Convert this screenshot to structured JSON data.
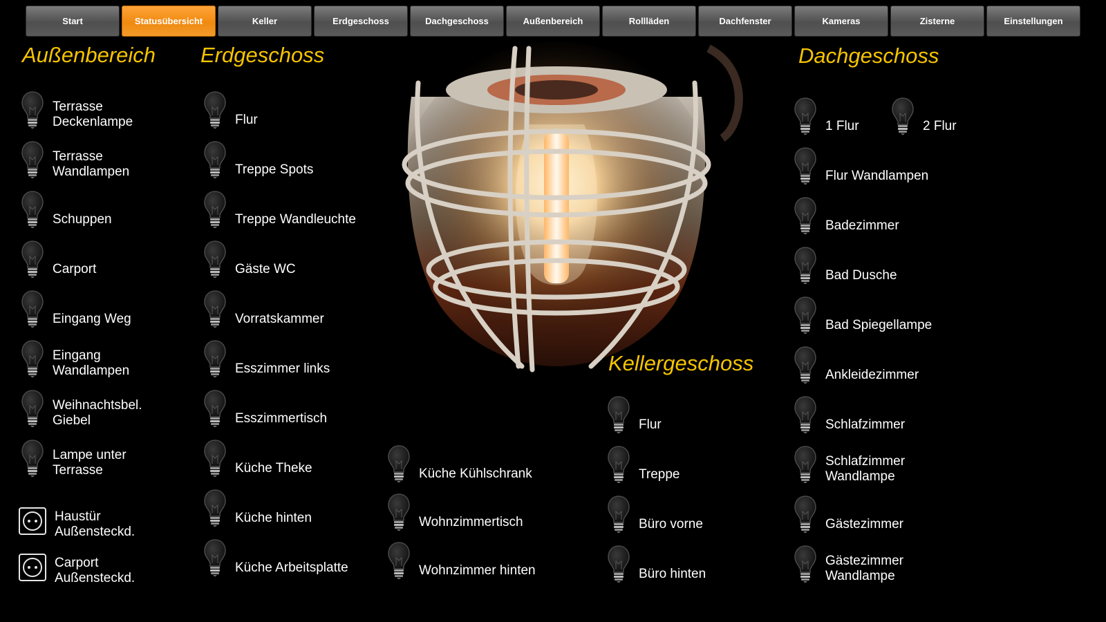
{
  "nav": {
    "tabs": [
      {
        "label": "Start",
        "active": false
      },
      {
        "label": "Statusübersicht",
        "active": true
      },
      {
        "label": "Keller",
        "active": false
      },
      {
        "label": "Erdgeschoss",
        "active": false
      },
      {
        "label": "Dachgeschoss",
        "active": false
      },
      {
        "label": "Außenbereich",
        "active": false
      },
      {
        "label": "Rollläden",
        "active": false
      },
      {
        "label": "Dachfenster",
        "active": false
      },
      {
        "label": "Kameras",
        "active": false
      },
      {
        "label": "Zisterne",
        "active": false
      },
      {
        "label": "Einstellungen",
        "active": false
      }
    ]
  },
  "colors": {
    "accent": "#f6c400",
    "active_tab": "#f59420",
    "tab": "#5f5f5f"
  },
  "sections": {
    "aussen": {
      "title": "Außenbereich",
      "items": [
        {
          "label": "Terrasse\nDeckenlampe",
          "icon": "bulb-icon"
        },
        {
          "label": "Terrasse\nWandlampen",
          "icon": "bulb-icon"
        },
        {
          "label": "Schuppen",
          "icon": "bulb-icon"
        },
        {
          "label": "Carport",
          "icon": "bulb-icon"
        },
        {
          "label": "Eingang Weg",
          "icon": "bulb-icon"
        },
        {
          "label": "Eingang\nWandlampen",
          "icon": "bulb-icon"
        },
        {
          "label": "Weihnachtsbel.\nGiebel",
          "icon": "bulb-icon"
        },
        {
          "label": "Lampe unter\nTerrasse",
          "icon": "bulb-icon"
        },
        {
          "label": "Haustür\nAußensteckd.",
          "icon": "socket-icon"
        },
        {
          "label": "Carport\nAußensteckd.",
          "icon": "socket-icon"
        }
      ]
    },
    "erd": {
      "title": "Erdgeschoss",
      "items": [
        {
          "label": "Flur",
          "icon": "bulb-icon"
        },
        {
          "label": "Treppe Spots",
          "icon": "bulb-icon"
        },
        {
          "label": "Treppe Wandleuchte",
          "icon": "bulb-icon"
        },
        {
          "label": "Gäste WC",
          "icon": "bulb-icon"
        },
        {
          "label": "Vorratskammer",
          "icon": "bulb-icon"
        },
        {
          "label": "Esszimmer links",
          "icon": "bulb-icon"
        },
        {
          "label": "Esszimmertisch",
          "icon": "bulb-icon"
        },
        {
          "label": "Küche Theke",
          "icon": "bulb-icon"
        },
        {
          "label": "Küche hinten",
          "icon": "bulb-icon"
        },
        {
          "label": "Küche Arbeitsplatte",
          "icon": "bulb-icon"
        }
      ],
      "extra_items": [
        {
          "label": "Küche Kühlschrank",
          "icon": "bulb-icon"
        },
        {
          "label": "Wohnzimmertisch",
          "icon": "bulb-icon"
        },
        {
          "label": "Wohnzimmer hinten",
          "icon": "bulb-icon"
        }
      ]
    },
    "keller": {
      "title": "Kellergeschoss",
      "items": [
        {
          "label": "Flur",
          "icon": "bulb-icon"
        },
        {
          "label": "Treppe",
          "icon": "bulb-icon"
        },
        {
          "label": "Büro vorne",
          "icon": "bulb-icon"
        },
        {
          "label": "Büro hinten",
          "icon": "bulb-icon"
        }
      ]
    },
    "dach": {
      "title": "Dachgeschoss",
      "items": [
        {
          "label": "1 Flur",
          "icon": "bulb-icon"
        },
        {
          "label": "2 Flur",
          "icon": "bulb-icon"
        },
        {
          "label": "Flur Wandlampen",
          "icon": "bulb-icon"
        },
        {
          "label": "Badezimmer",
          "icon": "bulb-icon"
        },
        {
          "label": "Bad Dusche",
          "icon": "bulb-icon"
        },
        {
          "label": "Bad Spiegellampe",
          "icon": "bulb-icon"
        },
        {
          "label": "Ankleidezimmer",
          "icon": "bulb-icon"
        },
        {
          "label": "Schlafzimmer",
          "icon": "bulb-icon"
        },
        {
          "label": "Schlafzimmer\nWandlampe",
          "icon": "bulb-icon"
        },
        {
          "label": "Gästezimmer",
          "icon": "bulb-icon"
        },
        {
          "label": "Gästezimmer\nWandlampe",
          "icon": "bulb-icon"
        }
      ]
    }
  }
}
